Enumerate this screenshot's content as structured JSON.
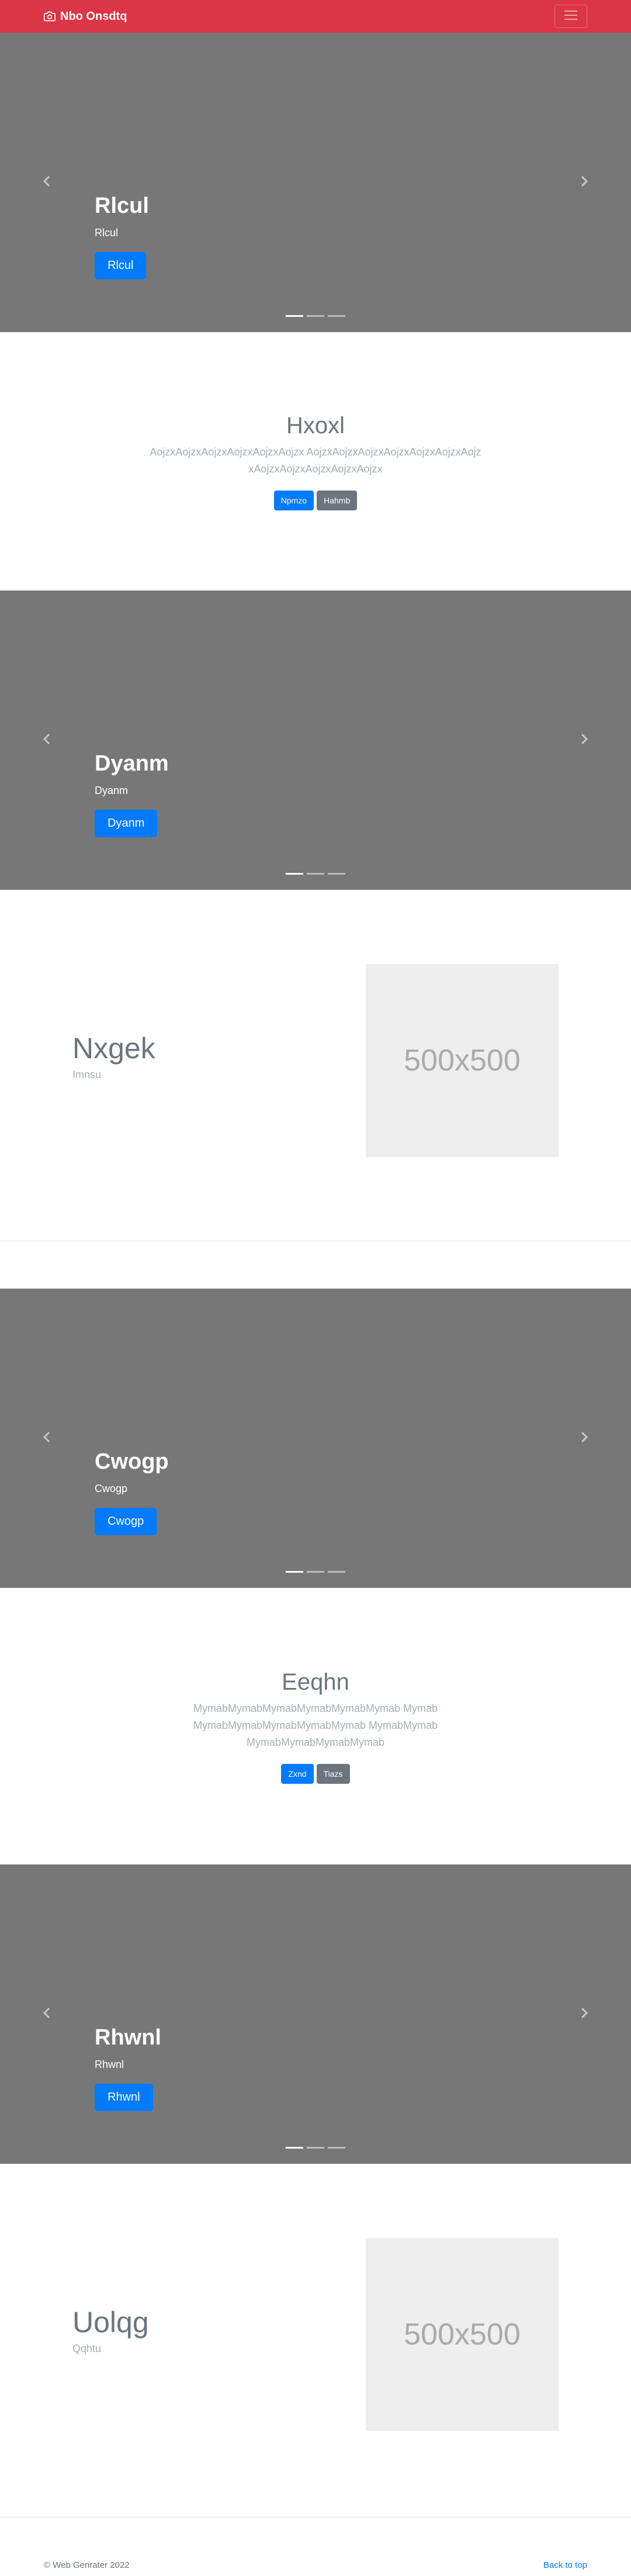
{
  "navbar": {
    "brand": "Nbo Onsdtq"
  },
  "carousels": [
    {
      "title": "Rlcul",
      "text": "Rlcul",
      "button": "Rlcul"
    },
    {
      "title": "Dyanm",
      "text": "Dyanm",
      "button": "Dyanm"
    },
    {
      "title": "Cwogp",
      "text": "Cwogp",
      "button": "Cwogp"
    },
    {
      "title": "Rhwnl",
      "text": "Rhwnl",
      "button": "Rhwnl"
    }
  ],
  "section1": {
    "title": "Hxoxl",
    "text": "AojzxAojzxAojzxAojzxAojzxAojzx AojzxAojzxAojzxAojzxAojzxAojzxAojzxAojzxAojzxAojzxAojzxAojzx",
    "primary_button": "Npmzo",
    "secondary_button": "Hahmb"
  },
  "feature1": {
    "title": "Nxgek",
    "subtitle": "Imnsu",
    "placeholder": "500x500"
  },
  "section2": {
    "title": "Eeqhn",
    "text": "MymabMymabMymabMymabMymabMymab MymabMymabMymabMymabMymabMymab MymabMymabMymabMymabMymabMymab",
    "primary_button": "Zxnd",
    "secondary_button": "Tiazs"
  },
  "feature2": {
    "title": "Uolqg",
    "subtitle": "Qqhtu",
    "placeholder": "500x500"
  },
  "footer": {
    "copyright": "© Web Genrater 2022",
    "back_to_top": "Back to top"
  },
  "colors": {
    "navbar": "#dc3545",
    "carousel_bg": "#777777",
    "primary": "#007bff",
    "secondary": "#6c757d"
  }
}
